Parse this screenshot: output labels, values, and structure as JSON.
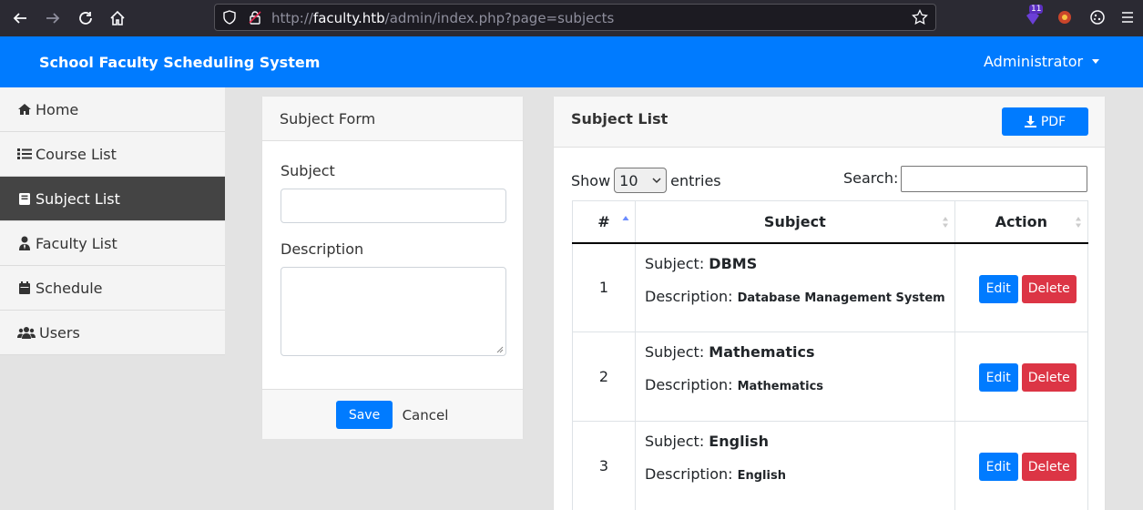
{
  "browser": {
    "url_prefix": "http://",
    "url_host": "faculty.htb",
    "url_path": "/admin/index.php?page=subjects",
    "extension_badge": "11"
  },
  "topbar": {
    "title": "School Faculty Scheduling System",
    "user_menu": "Administrator",
    "color": "#007bff"
  },
  "sidebar": {
    "items": [
      {
        "label": "Home",
        "icon": "home-icon",
        "active": false
      },
      {
        "label": "Course List",
        "icon": "list-icon",
        "active": false
      },
      {
        "label": "Subject List",
        "icon": "book-icon",
        "active": true
      },
      {
        "label": "Faculty List",
        "icon": "user-tie-icon",
        "active": false
      },
      {
        "label": "Schedule",
        "icon": "calendar-icon",
        "active": false
      },
      {
        "label": "Users",
        "icon": "users-icon",
        "active": false
      }
    ]
  },
  "form": {
    "title": "Subject Form",
    "subject_label": "Subject",
    "subject_value": "",
    "description_label": "Description",
    "description_value": "",
    "save_label": "Save",
    "cancel_label": "Cancel"
  },
  "list": {
    "title": "Subject List",
    "pdf_label": "PDF",
    "show_label": "Show",
    "entries_value": "10",
    "entries_label": "entries",
    "search_label": "Search:",
    "search_value": "",
    "columns": [
      "#",
      "Subject",
      "Action"
    ],
    "subject_prefix": "Subject:",
    "description_prefix": "Description:",
    "edit_label": "Edit",
    "delete_label": "Delete",
    "rows": [
      {
        "num": "1",
        "subject": "DBMS",
        "description": "Database Management System"
      },
      {
        "num": "2",
        "subject": "Mathematics",
        "description": "Mathematics"
      },
      {
        "num": "3",
        "subject": "English",
        "description": "English"
      }
    ]
  },
  "colors": {
    "primary": "#007bff",
    "danger": "#dc3545",
    "sidebar_active": "#444444"
  }
}
